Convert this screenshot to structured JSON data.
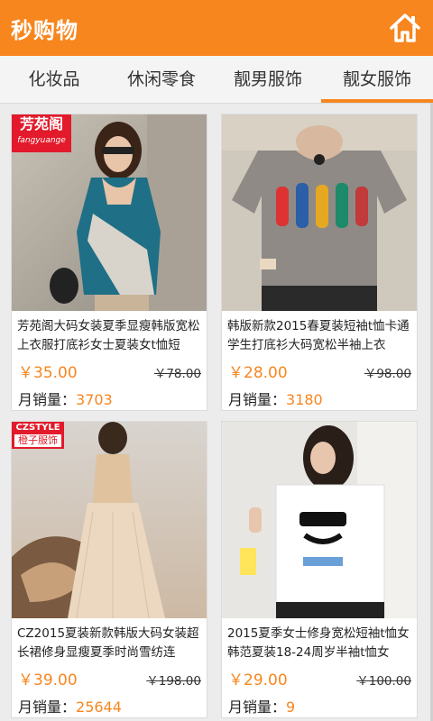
{
  "header": {
    "title": "秒购物",
    "home_icon": "home-icon"
  },
  "tabs": [
    {
      "label": "化妆品"
    },
    {
      "label": "休闲零食"
    },
    {
      "label": "靓男服饰"
    },
    {
      "label": "靓女服饰",
      "active": true
    }
  ],
  "colors": {
    "accent": "#f7861f",
    "teal": "#1f6f86"
  },
  "products": [
    {
      "badge": "芳苑阁",
      "badge_sub": "fangyuange",
      "desc": "芳苑阁大码女装夏季显瘦韩版宽松上衣服打底衫女士夏装女t恤短",
      "price": "￥35.00",
      "orig": "￥78.00",
      "sales_label": "月销量：",
      "sales": "3703"
    },
    {
      "badge": "",
      "desc": "韩版新款2015春夏装短袖t恤卡通学生打底衫大码宽松半袖上衣",
      "price": "￥28.00",
      "orig": "￥98.00",
      "sales_label": "月销量：",
      "sales": "3180"
    },
    {
      "badge": "CZSTYLE",
      "badge_sub": "橙子服饰",
      "desc": "CZ2015夏装新款韩版大码女装超长裙修身显瘦夏季时尚雪纺连",
      "price": "￥39.00",
      "orig": "￥198.00",
      "sales_label": "月销量：",
      "sales": "25644"
    },
    {
      "badge": "",
      "desc": "2015夏季女士修身宽松短袖t恤女韩范夏装18-24周岁半袖t恤女",
      "price": "￥29.00",
      "orig": "￥100.00",
      "sales_label": "月销量：",
      "sales": "9"
    }
  ]
}
